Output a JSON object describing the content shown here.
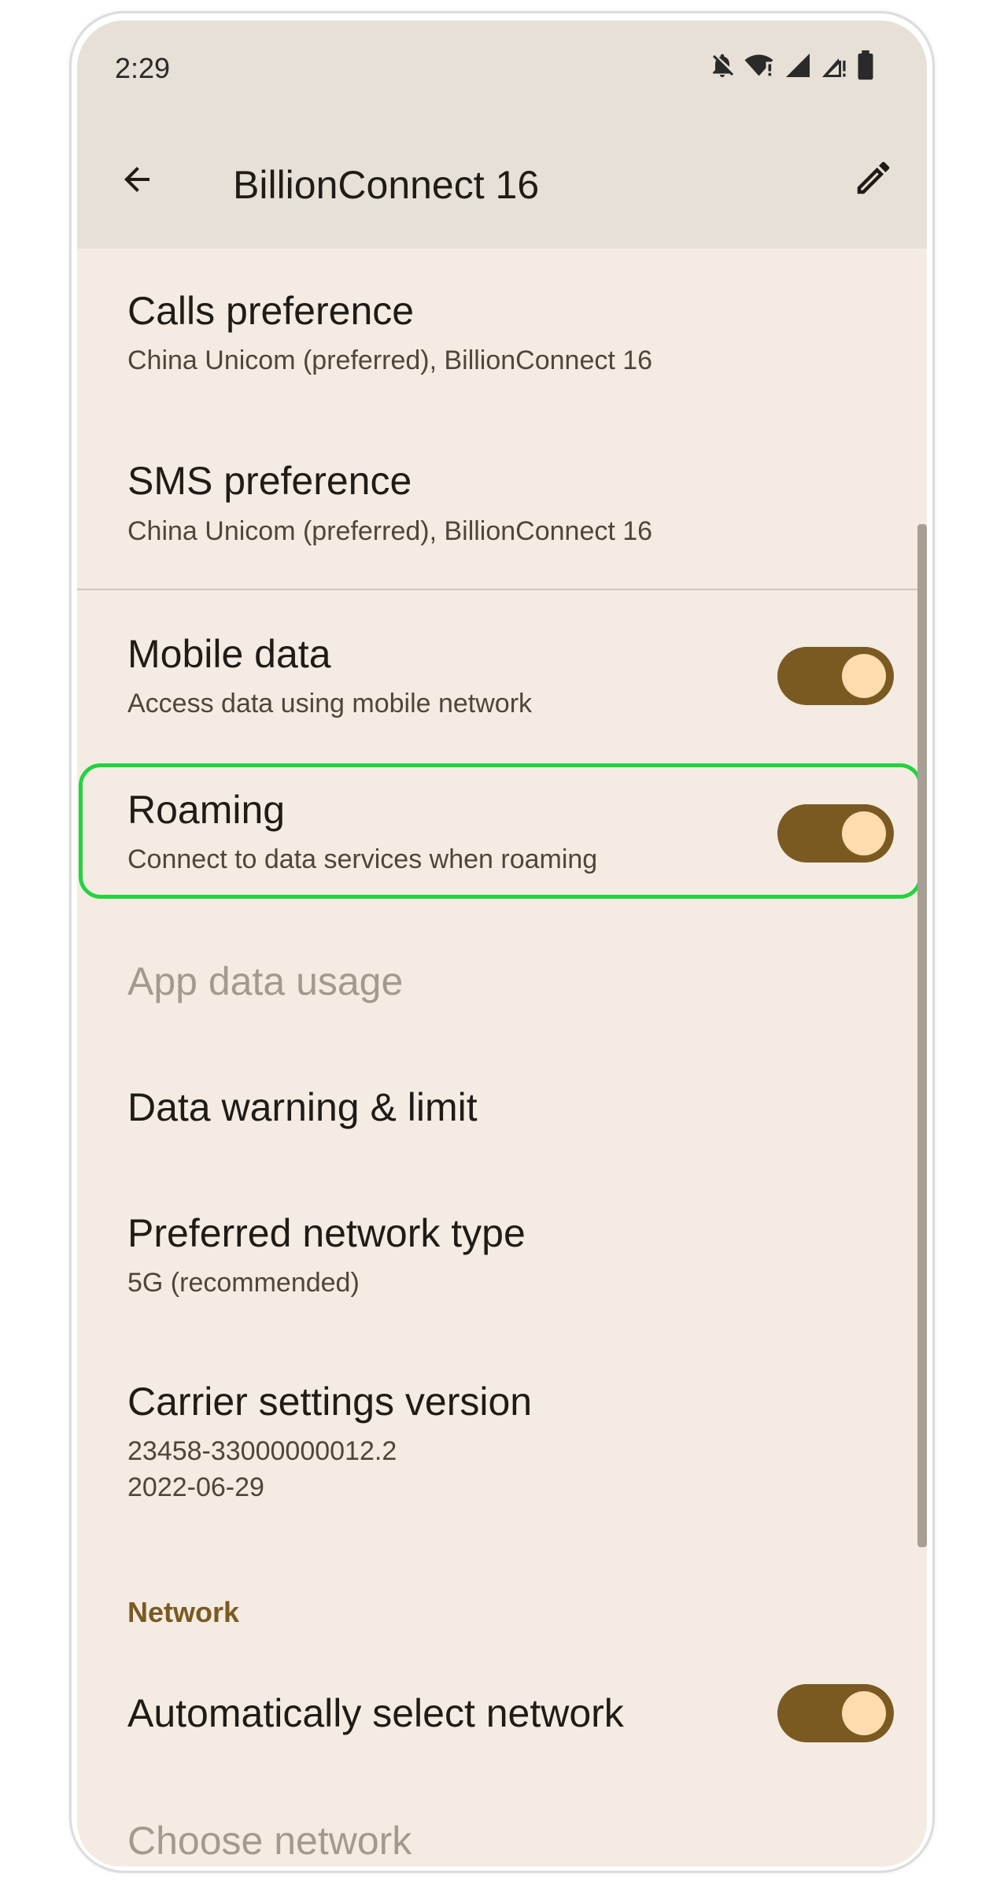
{
  "status_bar": {
    "time": "2:29",
    "icons": [
      "notifications-off-icon",
      "wifi-alert-icon",
      "signal-icon",
      "signal-alert-icon",
      "battery-icon"
    ]
  },
  "app_bar": {
    "title": "BillionConnect 16",
    "back_icon": "arrow-back-icon",
    "edit_icon": "edit-pencil-icon"
  },
  "settings": {
    "calls_preference": {
      "title": "Calls preference",
      "summary": "China Unicom (preferred), BillionConnect 16"
    },
    "sms_preference": {
      "title": "SMS preference",
      "summary": "China Unicom (preferred), BillionConnect 16"
    },
    "mobile_data": {
      "title": "Mobile data",
      "summary": "Access data using mobile network",
      "enabled": true
    },
    "roaming": {
      "title": "Roaming",
      "summary": "Connect to data services when roaming",
      "enabled": true
    },
    "app_data_usage": {
      "title": "App data usage",
      "disabled": true
    },
    "data_warning": {
      "title": "Data warning & limit"
    },
    "preferred_network": {
      "title": "Preferred network type",
      "summary": "5G (recommended)"
    },
    "carrier_settings": {
      "title": "Carrier settings version",
      "summary_line1": "23458-33000000012.2",
      "summary_line2": "2022-06-29"
    }
  },
  "network_section": {
    "header": "Network",
    "auto_select": {
      "title": "Automatically select network",
      "enabled": true
    },
    "choose_network": {
      "title": "Choose network",
      "disabled": true
    }
  },
  "colors": {
    "background": "#f4ece3",
    "app_bar": "#e7e0d6",
    "accent": "#7b5a22",
    "toggle_thumb": "#fddcae",
    "highlight": "#22d33f"
  }
}
